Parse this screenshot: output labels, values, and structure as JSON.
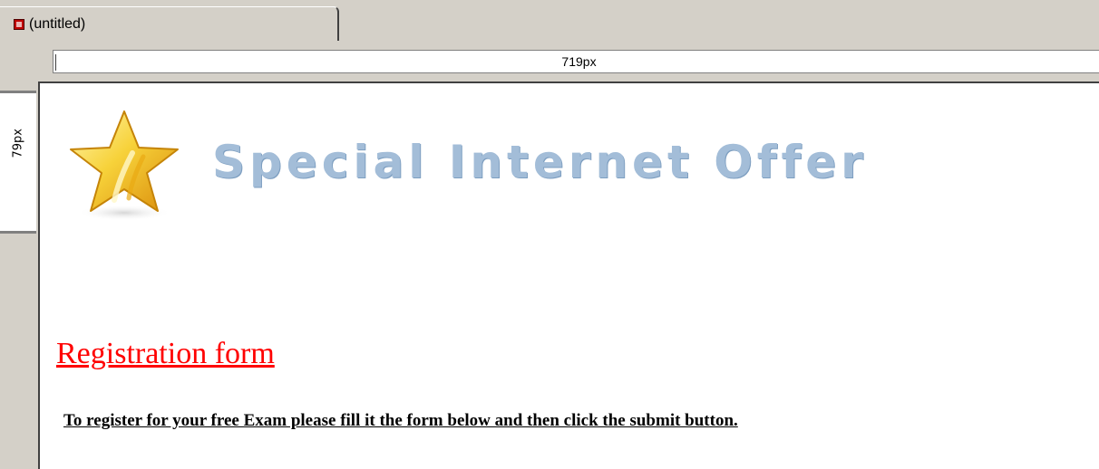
{
  "document_tab": {
    "title": "(untitled)",
    "icon": "document-icon"
  },
  "horizontal_ruler": {
    "label": "719px"
  },
  "vertical_ruler": {
    "label": "79px"
  },
  "page": {
    "star_icon": "star-icon",
    "banner_text": "Special Internet Offer",
    "heading": "Registration form",
    "instructions": "To register for your free Exam please fill it the form below and then click the submit button."
  },
  "colors": {
    "heading": "#ff0000",
    "banner": "#a3bdd8",
    "chrome": "#d4d0c8"
  }
}
